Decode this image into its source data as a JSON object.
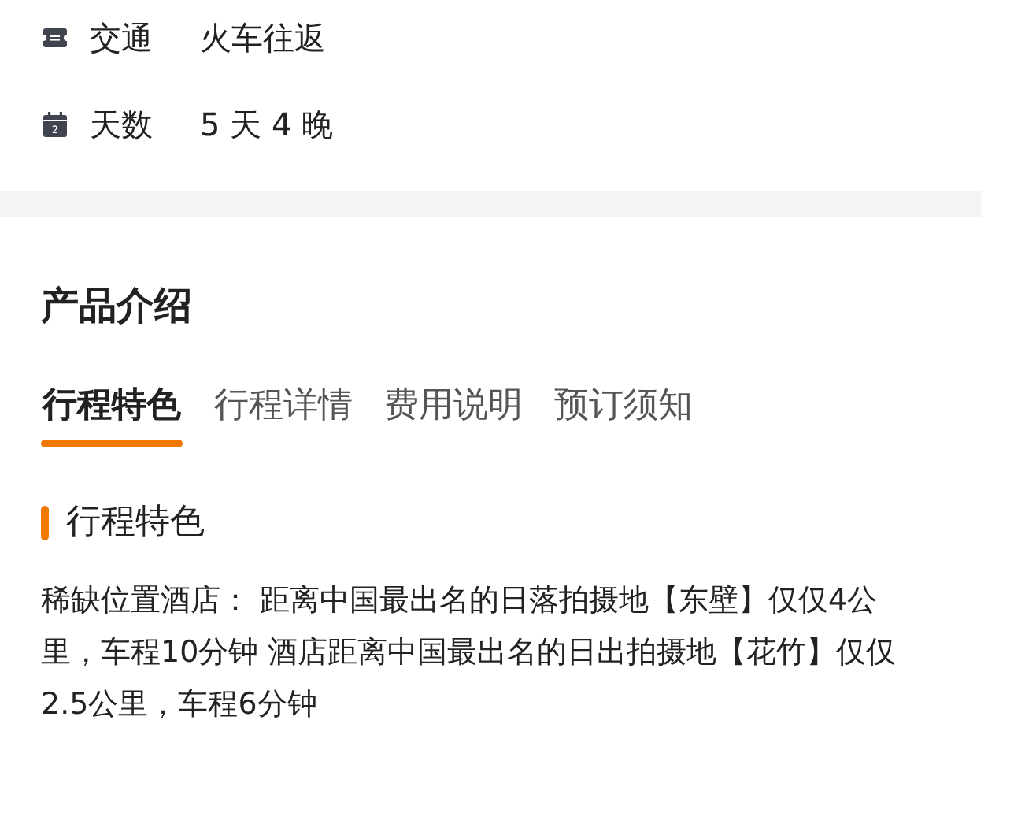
{
  "info_rows": [
    {
      "kind": "transport",
      "label": "交通",
      "value": "火车往返"
    },
    {
      "kind": "calendar",
      "icon_text": "2",
      "label": "天数",
      "value": "5 天 4 晚"
    }
  ],
  "section_title": "产品介绍",
  "tabs": [
    {
      "label": "行程特色",
      "selected": true
    },
    {
      "label": "行程详情",
      "selected": false
    },
    {
      "label": "费用说明",
      "selected": false
    },
    {
      "label": "预订须知",
      "selected": false
    }
  ],
  "feature": {
    "heading": "行程特色",
    "text": "稀缺位置酒店： 距离中国最出名的日落拍摄地【东壁】仅仅4公里，车程10分钟 酒店距离中国最出名的日出拍摄地【花竹】仅仅2.5公里，车程6分钟"
  }
}
